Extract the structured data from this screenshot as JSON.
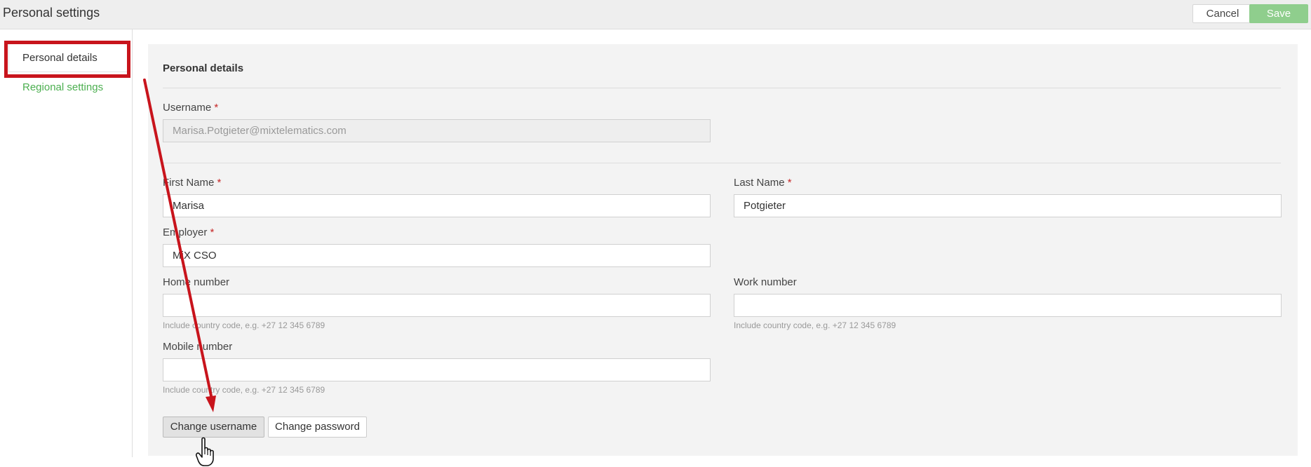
{
  "header": {
    "title": "Personal settings",
    "cancel_label": "Cancel",
    "save_label": "Save"
  },
  "sidebar": {
    "items": [
      {
        "label": "Personal details",
        "active": true
      },
      {
        "label": "Regional settings",
        "active": false
      }
    ]
  },
  "form": {
    "section_title": "Personal details",
    "username": {
      "label": "Username",
      "value": "Marisa.Potgieter@mixtelematics.com",
      "required": true
    },
    "first_name": {
      "label": "First Name",
      "value": "Marisa",
      "required": true
    },
    "last_name": {
      "label": "Last Name",
      "value": "Potgieter",
      "required": true
    },
    "employer": {
      "label": "Employer",
      "value": "MiX CSO",
      "required": true
    },
    "home_number": {
      "label": "Home number",
      "value": "",
      "hint": "Include country code, e.g. +27 12 345 6789"
    },
    "work_number": {
      "label": "Work number",
      "value": "",
      "hint": "Include country code, e.g. +27 12 345 6789"
    },
    "mobile_number": {
      "label": "Mobile number",
      "value": "",
      "hint": "Include country code, e.g. +27 12 345 6789"
    },
    "required_marker": "*",
    "change_username_label": "Change username",
    "change_password_label": "Change password"
  },
  "colors": {
    "accent_green": "#4caf50",
    "save_green": "#8fce8d",
    "annotation_red": "#c8141c",
    "required_red": "#c62828"
  },
  "icons": {
    "cursor": "hand-pointer-icon"
  }
}
